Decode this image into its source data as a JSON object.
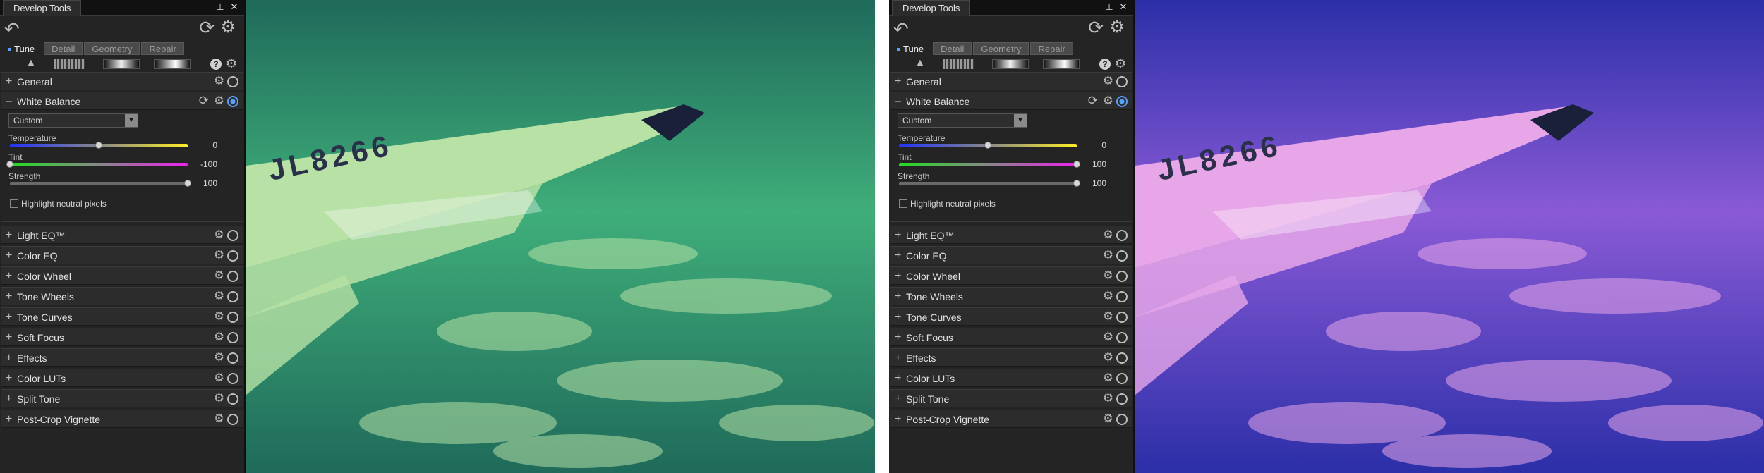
{
  "panels": [
    {
      "title": "Develop Tools",
      "pin_icon": "pin-icon",
      "close_label": "✕",
      "tabs": [
        "Tune",
        "Detail",
        "Geometry",
        "Repair"
      ],
      "active_tab": "Tune",
      "sections_top": [
        {
          "label": "General"
        }
      ],
      "white_balance": {
        "label": "White Balance",
        "preset": "Custom",
        "sliders": [
          {
            "label": "Temperature",
            "value": "0",
            "fraction": 0.5
          },
          {
            "label": "Tint",
            "value": "-100",
            "fraction": 0.0
          },
          {
            "label": "Strength",
            "value": "100",
            "fraction": 1.0
          }
        ],
        "checkbox_label": "Highlight neutral pixels"
      },
      "sections": [
        {
          "label": "Light EQ™"
        },
        {
          "label": "Color EQ"
        },
        {
          "label": "Color Wheel"
        },
        {
          "label": "Tone Wheels"
        },
        {
          "label": "Tone Curves"
        },
        {
          "label": "Soft Focus"
        },
        {
          "label": "Effects"
        },
        {
          "label": "Color LUTs"
        },
        {
          "label": "Split Tone"
        },
        {
          "label": "Post-Crop Vignette"
        }
      ],
      "photo_tint": "#3fae7a",
      "photo_sky": "#1f6a5a",
      "photo_wing": "#b7e1a5",
      "wing_text": "JL8266"
    },
    {
      "title": "Develop Tools",
      "pin_icon": "pin-icon",
      "close_label": "✕",
      "tabs": [
        "Tune",
        "Detail",
        "Geometry",
        "Repair"
      ],
      "active_tab": "Tune",
      "sections_top": [
        {
          "label": "General"
        }
      ],
      "white_balance": {
        "label": "White Balance",
        "preset": "Custom",
        "sliders": [
          {
            "label": "Temperature",
            "value": "0",
            "fraction": 0.5
          },
          {
            "label": "Tint",
            "value": "100",
            "fraction": 1.0
          },
          {
            "label": "Strength",
            "value": "100",
            "fraction": 1.0
          }
        ],
        "checkbox_label": "Highlight neutral pixels"
      },
      "sections": [
        {
          "label": "Light EQ™"
        },
        {
          "label": "Color EQ"
        },
        {
          "label": "Color Wheel"
        },
        {
          "label": "Tone Wheels"
        },
        {
          "label": "Tone Curves"
        },
        {
          "label": "Soft Focus"
        },
        {
          "label": "Effects"
        },
        {
          "label": "Color LUTs"
        },
        {
          "label": "Split Tone"
        },
        {
          "label": "Post-Crop Vignette"
        }
      ],
      "photo_tint": "#8a5ad6",
      "photo_sky": "#2b2fa8",
      "photo_wing": "#e6a6e8",
      "wing_text": "JL8266"
    }
  ]
}
